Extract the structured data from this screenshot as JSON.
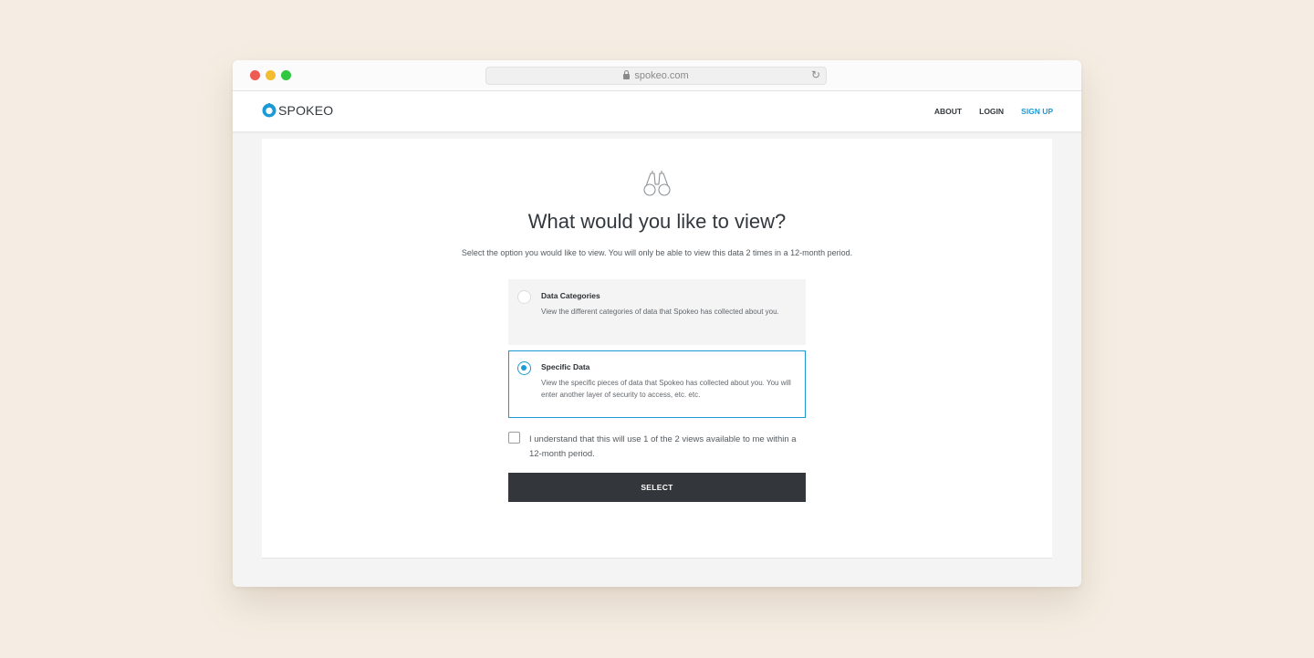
{
  "browser": {
    "url": "spokeo.com"
  },
  "header": {
    "logo_text": "SPOKEO",
    "nav": {
      "about": "ABOUT",
      "login": "LOGIN",
      "signup": "SIGN UP"
    }
  },
  "main": {
    "title": "What would you like to view?",
    "subtitle": "Select the option you would like to view. You will only be able to view this data 2 times in a 12-month period.",
    "options": [
      {
        "title": "Data Categories",
        "description": "View the different categories of data that Spokeo has collected about you.",
        "selected": false
      },
      {
        "title": "Specific Data",
        "description": "View the specific pieces of data that Spokeo has collected about you. You will enter another layer of security to access, etc. etc.",
        "selected": true
      }
    ],
    "acknowledge_label": "I understand that this will use 1 of the 2 views available to me within a 12-month period.",
    "acknowledge_checked": false,
    "select_button": "SELECT"
  },
  "colors": {
    "accent": "#1c9ad6",
    "button_bg": "#33373b",
    "page_bg": "#f5ede3"
  },
  "icons": [
    "lock-icon",
    "reload-icon",
    "spokeo-logo-icon",
    "binoculars-icon"
  ]
}
